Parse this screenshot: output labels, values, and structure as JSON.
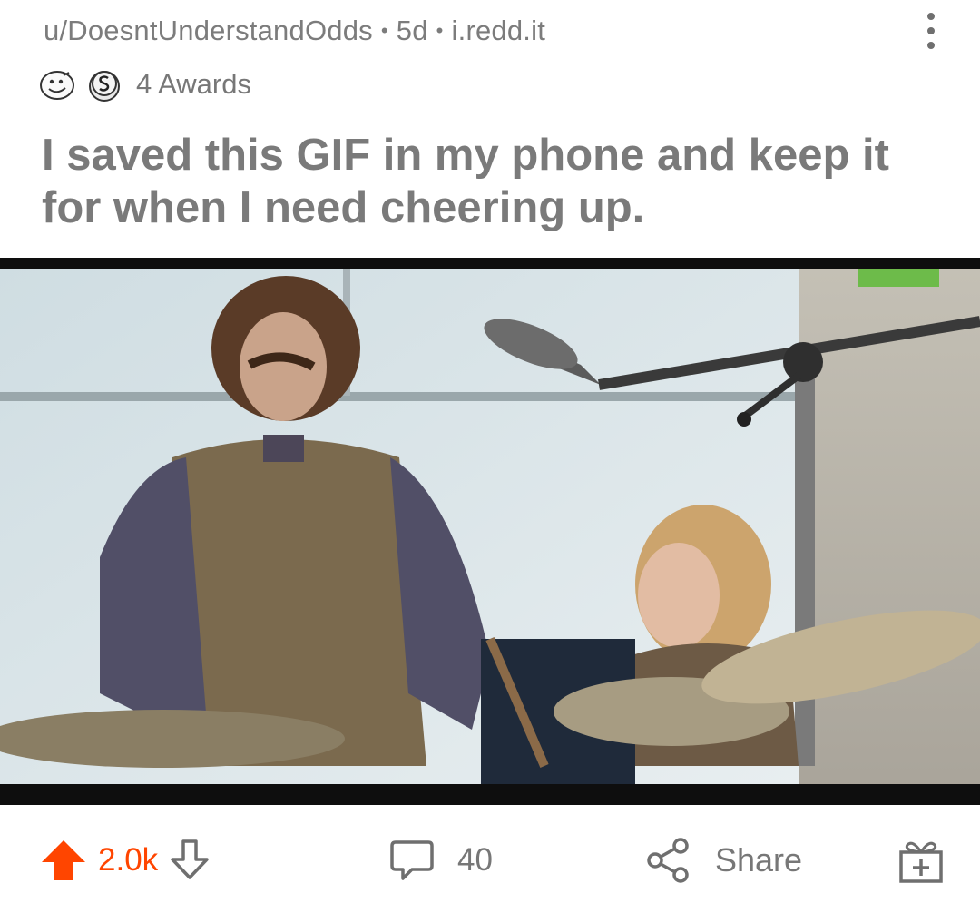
{
  "post": {
    "author": "u/DoesntUnderstandOdds",
    "age": "5d",
    "domain": "i.redd.it",
    "awards_label": "4 Awards",
    "title": "I saved this GIF in my phone and keep it for when I need cheering up."
  },
  "actions": {
    "score": "2.0k",
    "comments": "40",
    "share_label": "Share"
  },
  "colors": {
    "upvote_active": "#ff4500",
    "text_muted": "#7a7a7a"
  },
  "icons": [
    "more-vertical-icon",
    "award-face-icon",
    "award-coin-icon",
    "upvote-icon",
    "downvote-icon",
    "comment-icon",
    "share-icon",
    "gift-icon"
  ]
}
